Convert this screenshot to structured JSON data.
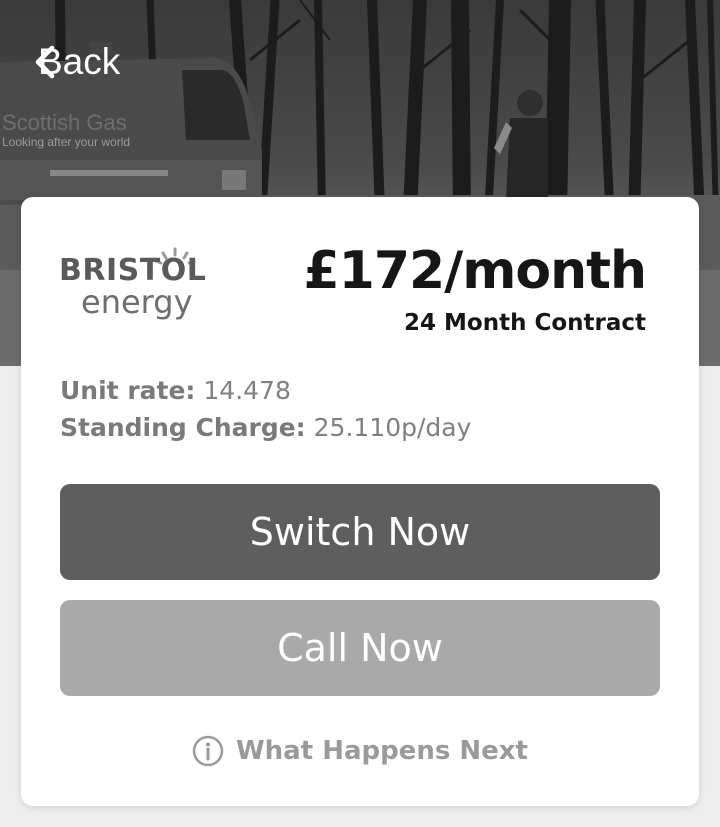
{
  "header": {
    "back_label": "Back",
    "back_icon": "chevron-left-icon"
  },
  "hero": {
    "van_brand": "Scottish Gas",
    "van_tagline": "Looking after your world"
  },
  "supplier": {
    "logo_line1": "BRISTOL",
    "logo_line2": "energy"
  },
  "price": {
    "amount": "£172/month",
    "contract": "24 Month Contract"
  },
  "rates": {
    "unit_rate_label": "Unit rate:",
    "unit_rate_value": "14.478",
    "standing_charge_label": "Standing Charge:",
    "standing_charge_value": "25.110p/day"
  },
  "actions": {
    "switch_label": "Switch Now",
    "call_label": "Call Now",
    "next_label": "What Happens Next",
    "next_icon": "info-icon"
  }
}
